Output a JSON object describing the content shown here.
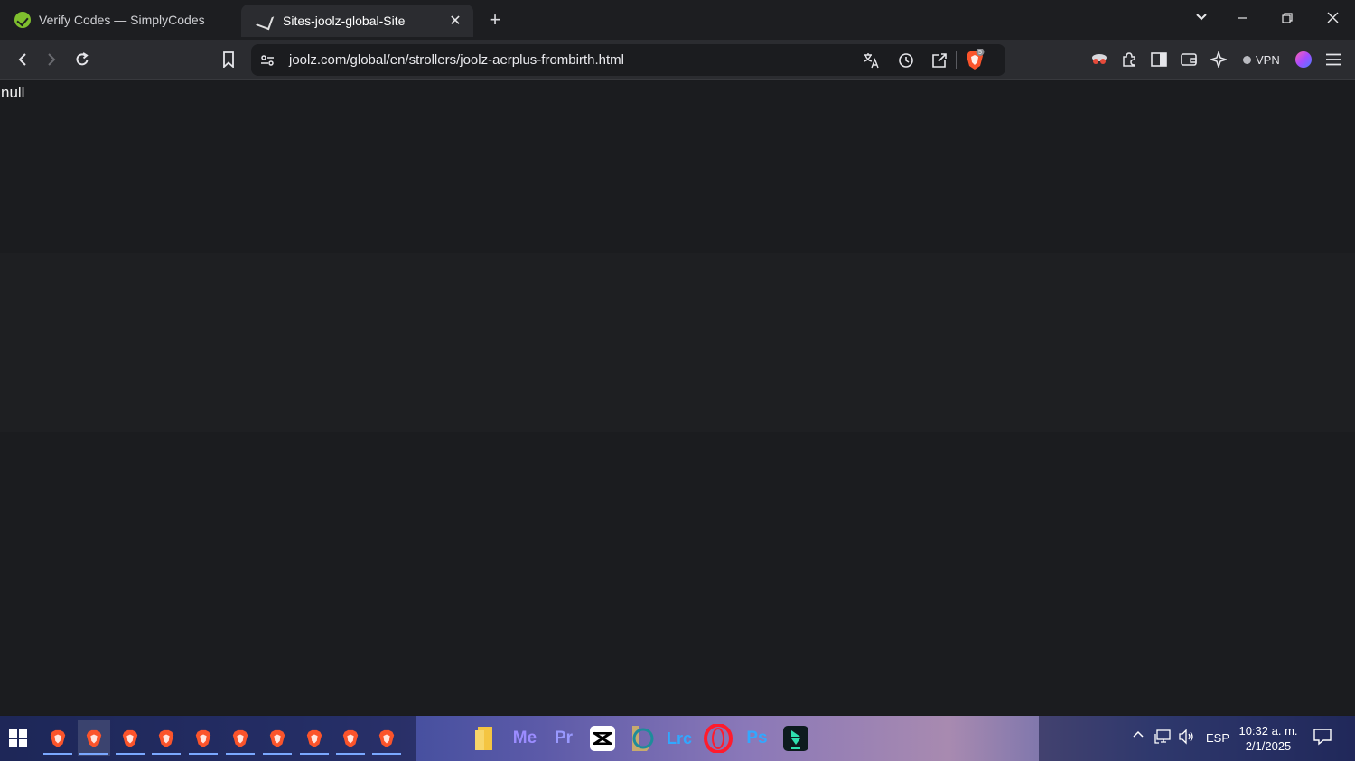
{
  "tabs": [
    {
      "title": "Verify Codes — SimplyCodes",
      "active": false
    },
    {
      "title": "Sites-joolz-global-Site",
      "active": true
    }
  ],
  "tab_close_glyph": "✕",
  "new_tab_glyph": "+",
  "window_controls": {
    "list_glyph": "⌄",
    "minimize_glyph": "—",
    "restore_glyph": "❐",
    "close_glyph": "✕"
  },
  "address_bar": {
    "url": "joolz.com/global/en/strollers/joolz-aerplus-frombirth.html"
  },
  "shields_badge": "5",
  "vpn_label": "VPN",
  "page": {
    "body_text": "null"
  },
  "taskbar": {
    "apps": [
      {
        "name": "Me",
        "color": "#9b8cff",
        "bg": "#0c0a3e"
      },
      {
        "name": "Pr",
        "color": "#9999ff",
        "bg": "#00005b"
      },
      {
        "name": "Lrc",
        "color": "#31a8ff",
        "bg": "#001e36"
      },
      {
        "name": "Ps",
        "color": "#31a8ff",
        "bg": "#001e36"
      }
    ],
    "language": "ESP",
    "time": "10:32 a. m.",
    "date": "2/1/2025"
  },
  "colors": {
    "accent": "#7aa8ff",
    "brave_orange": "#fb542b"
  }
}
